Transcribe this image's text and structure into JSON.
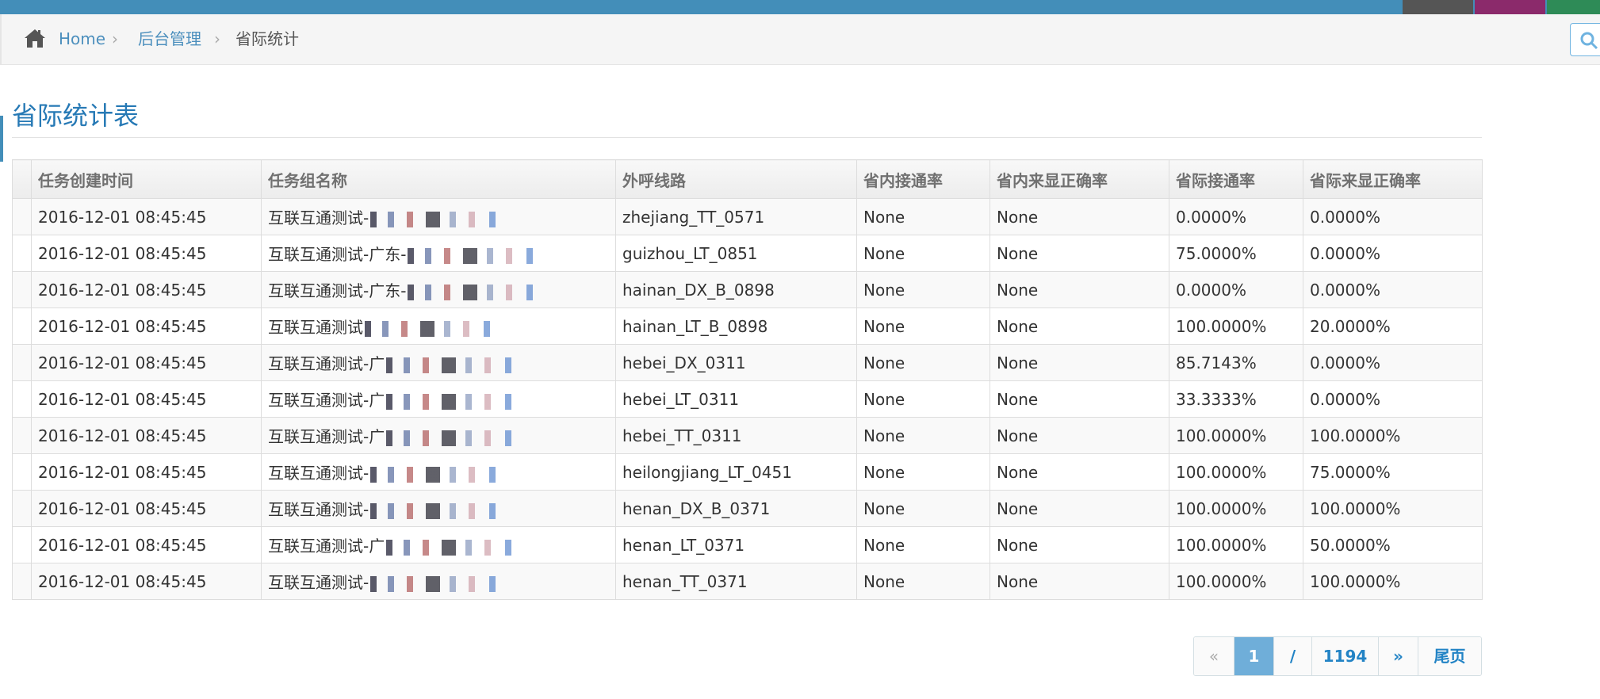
{
  "colors": {
    "navbar": "#438eb9",
    "link": "#4c8fbd",
    "title": "#2679b5",
    "pager_current_bg": "#6faed9",
    "skin_swatches": [
      "#555555",
      "#8b2a6b",
      "#2e8b57"
    ]
  },
  "icons": {
    "home": "home-icon",
    "search": "search-icon"
  },
  "breadcrumb": {
    "items": [
      {
        "label": "Home",
        "link": true
      },
      {
        "label": "后台管理",
        "link": true
      },
      {
        "label": "省际统计",
        "link": false
      }
    ],
    "separator": "›"
  },
  "page": {
    "title": "省际统计表"
  },
  "table": {
    "columns": [
      "任务创建时间",
      "任务组名称",
      "外呼线路",
      "省内接通率",
      "省内来显正确率",
      "省际接通率",
      "省际来显正确率"
    ],
    "rows": [
      {
        "created": "2016-12-01 08:45:45",
        "group": "互联互通测试-",
        "route": "zhejiang_TT_0571",
        "in_rate": "None",
        "in_display": "None",
        "inter_rate": "0.0000%",
        "inter_display": "0.0000%"
      },
      {
        "created": "2016-12-01 08:45:45",
        "group": "互联互通测试-广东-",
        "route": "guizhou_LT_0851",
        "in_rate": "None",
        "in_display": "None",
        "inter_rate": "75.0000%",
        "inter_display": "0.0000%"
      },
      {
        "created": "2016-12-01 08:45:45",
        "group": "互联互通测试-广东-",
        "route": "hainan_DX_B_0898",
        "in_rate": "None",
        "in_display": "None",
        "inter_rate": "0.0000%",
        "inter_display": "0.0000%"
      },
      {
        "created": "2016-12-01 08:45:45",
        "group": "互联互通测试",
        "route": "hainan_LT_B_0898",
        "in_rate": "None",
        "in_display": "None",
        "inter_rate": "100.0000%",
        "inter_display": "20.0000%"
      },
      {
        "created": "2016-12-01 08:45:45",
        "group": "互联互通测试-广",
        "route": "hebei_DX_0311",
        "in_rate": "None",
        "in_display": "None",
        "inter_rate": "85.7143%",
        "inter_display": "0.0000%"
      },
      {
        "created": "2016-12-01 08:45:45",
        "group": "互联互通测试-广",
        "route": "hebei_LT_0311",
        "in_rate": "None",
        "in_display": "None",
        "inter_rate": "33.3333%",
        "inter_display": "0.0000%"
      },
      {
        "created": "2016-12-01 08:45:45",
        "group": "互联互通测试-广",
        "route": "hebei_TT_0311",
        "in_rate": "None",
        "in_display": "None",
        "inter_rate": "100.0000%",
        "inter_display": "100.0000%"
      },
      {
        "created": "2016-12-01 08:45:45",
        "group": "互联互通测试-",
        "route": "heilongjiang_LT_0451",
        "in_rate": "None",
        "in_display": "None",
        "inter_rate": "100.0000%",
        "inter_display": "75.0000%"
      },
      {
        "created": "2016-12-01 08:45:45",
        "group": "互联互通测试-",
        "route": "henan_DX_B_0371",
        "in_rate": "None",
        "in_display": "None",
        "inter_rate": "100.0000%",
        "inter_display": "100.0000%"
      },
      {
        "created": "2016-12-01 08:45:45",
        "group": "互联互通测试-广",
        "route": "henan_LT_0371",
        "in_rate": "None",
        "in_display": "None",
        "inter_rate": "100.0000%",
        "inter_display": "50.0000%"
      },
      {
        "created": "2016-12-01 08:45:45",
        "group": "互联互通测试-",
        "route": "henan_TT_0371",
        "in_rate": "None",
        "in_display": "None",
        "inter_rate": "100.0000%",
        "inter_display": "100.0000%"
      }
    ]
  },
  "pagination": {
    "prev": "«",
    "current": "1",
    "divider": "/",
    "total": "1194",
    "next": "»",
    "last": "尾页"
  }
}
